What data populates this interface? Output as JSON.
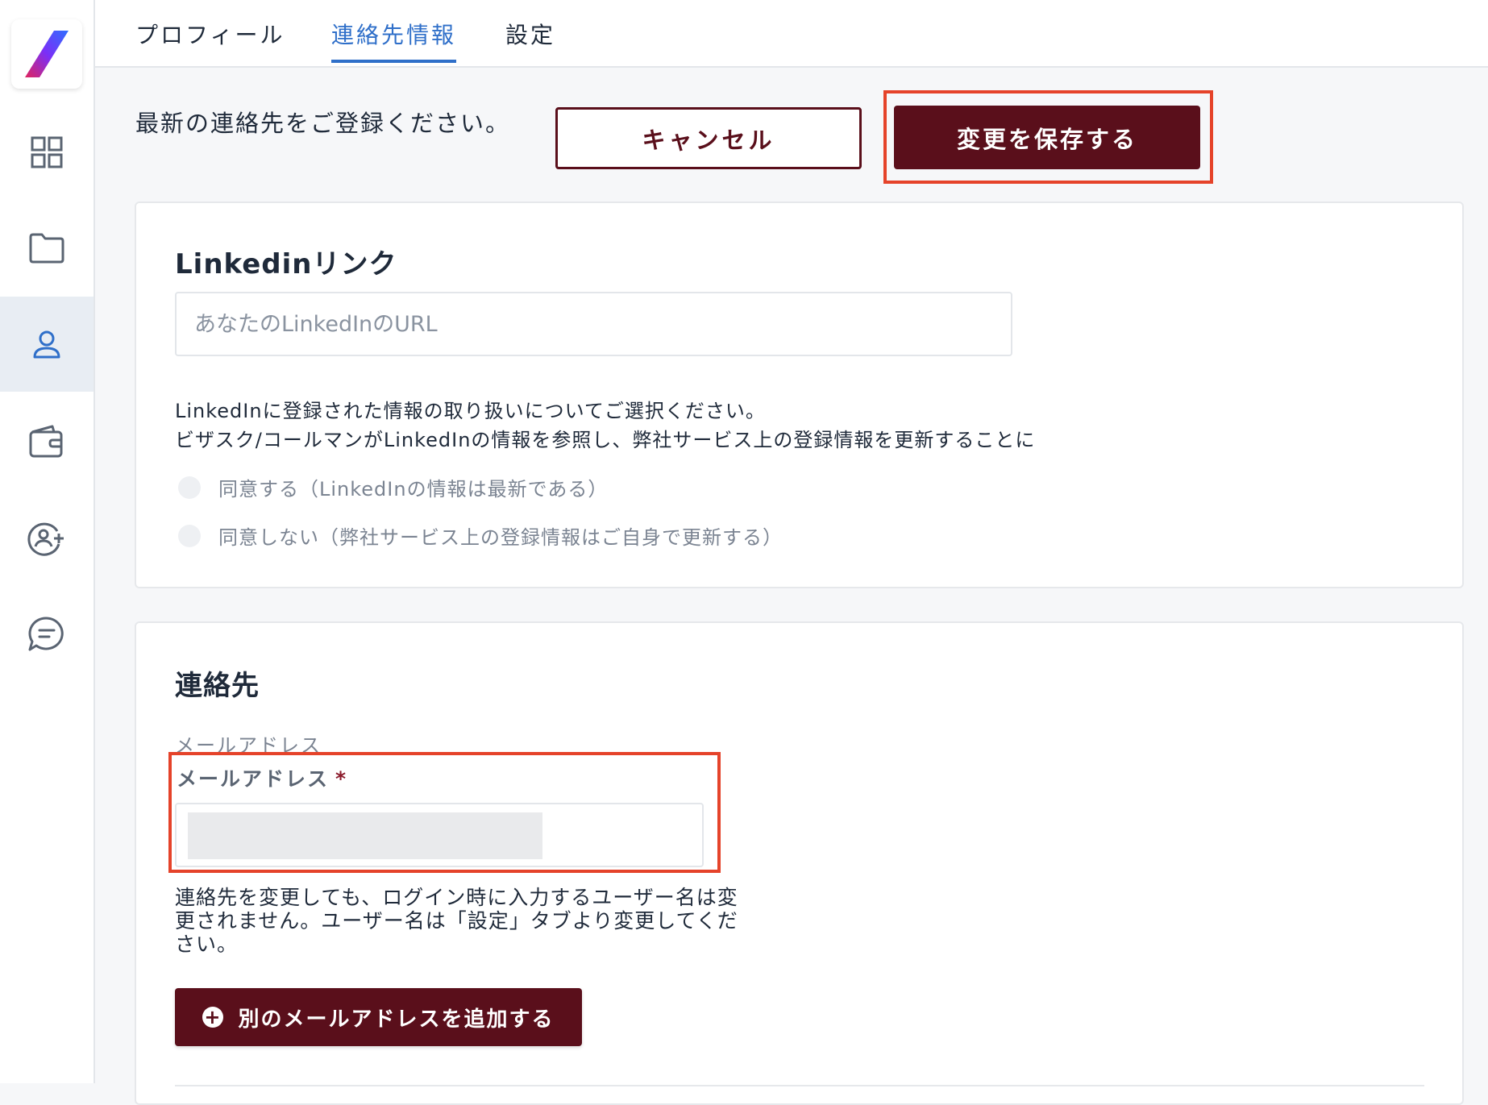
{
  "tabs": [
    {
      "label": "プロフィール"
    },
    {
      "label": "連絡先情報"
    },
    {
      "label": "設定"
    }
  ],
  "active_tab": "連絡先情報",
  "header": {
    "intro": "最新の連絡先をご登録ください。",
    "cancel_label": "キャンセル",
    "save_label": "変更を保存する"
  },
  "linkedin": {
    "title": "Linkedinリンク",
    "url_placeholder": "あなたのLinkedInのURL",
    "desc_line1": "LinkedInに登録された情報の取り扱いについてご選択ください。",
    "desc_line2": "ビザスク/コールマンがLinkedInの情報を参照し、弊社サービス上の登録情報を更新することに",
    "option_agree": "同意する（LinkedInの情報は最新である）",
    "option_disagree": "同意しない（弊社サービス上の登録情報はご自身で更新する）"
  },
  "contact": {
    "title": "連絡先",
    "email_caption": "メールアドレス",
    "email_label": "メールアドレス",
    "required_mark": "*",
    "note": "連絡先を変更しても、ログイン時に入力するユーザー名は変更されません。ユーザー名は「設定」タブより変更してください。",
    "add_email_label": "別のメールアドレスを追加する",
    "add_icon": "+"
  },
  "sidebar": {
    "items": [
      {
        "icon": "dashboard-grid-icon"
      },
      {
        "icon": "folder-icon"
      },
      {
        "icon": "user-icon",
        "active": true
      },
      {
        "icon": "wallet-icon"
      },
      {
        "icon": "user-add-icon"
      },
      {
        "icon": "chat-icon"
      }
    ]
  },
  "colors": {
    "brand_dark": "#5a0f1b",
    "accent_blue": "#2f6fc9",
    "highlight_red": "#e5432a"
  }
}
